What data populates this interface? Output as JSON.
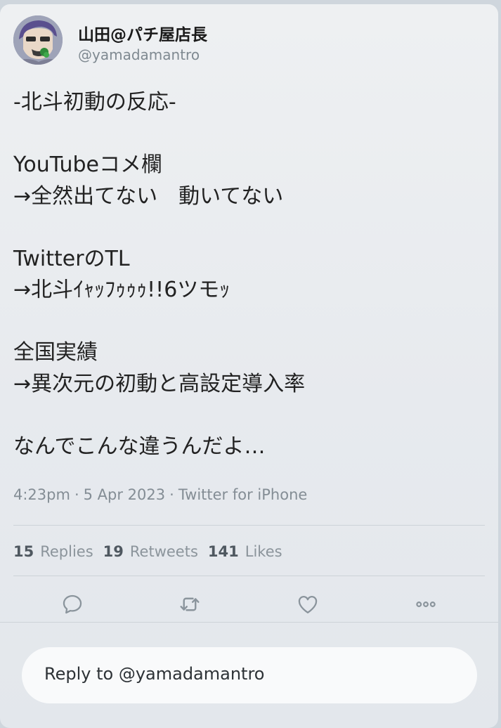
{
  "user": {
    "display_name": "山田@パチ屋店長",
    "handle": "@yamadamantro"
  },
  "tweet": {
    "lines": [
      "-北斗初動の反応-",
      "",
      "YouTubeコメ欄",
      "→全然出てない　動いてない",
      "",
      "TwitterのTL",
      "→北斗ｲｬｯﾌｩｩｩ!!6ツモｯ",
      "",
      "全国実績",
      "→異次元の初動と高設定導入率",
      "",
      "なんでこんな違うんだよ…"
    ],
    "time": "4:23pm",
    "separator": "·",
    "date": "5 Apr 2023",
    "source": "Twitter for iPhone"
  },
  "stats": {
    "replies_count": "15",
    "replies_label": "Replies",
    "retweets_count": "19",
    "retweets_label": "Retweets",
    "likes_count": "141",
    "likes_label": "Likes"
  },
  "actions": {
    "icons": [
      "reply-icon",
      "retweet-icon",
      "like-icon",
      "more-icon"
    ],
    "icon_color": "#8a949c"
  },
  "reply_box": {
    "text": "Reply to @yamadamantro"
  }
}
